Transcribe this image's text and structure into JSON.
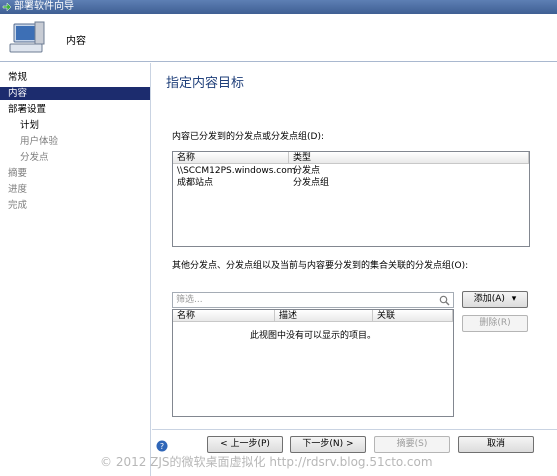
{
  "window": {
    "title": "部署软件向导"
  },
  "header": {
    "title": "内容",
    "icon": "computer-icon"
  },
  "sidebar": {
    "items": [
      {
        "label": "常规"
      },
      {
        "label": "内容"
      },
      {
        "label": "部署设置"
      },
      {
        "label": "计划"
      },
      {
        "label": "用户体验"
      },
      {
        "label": "分发点"
      },
      {
        "label": "摘要"
      },
      {
        "label": "进度"
      },
      {
        "label": "完成"
      }
    ]
  },
  "main": {
    "heading": "指定内容目标",
    "distributed_label": "内容已分发到的分发点或分发点组(D):",
    "distributed_list": {
      "columns": [
        "名称",
        "类型"
      ],
      "rows": [
        [
          "\\\\SCCM12PS.windows.com",
          "分发点"
        ],
        [
          "成都站点",
          "分发点组"
        ]
      ]
    },
    "other_label": "其他分发点、分发点组以及当前与内容要分发到的集合关联的分发点组(O):",
    "filter_placeholder": "筛选...",
    "other_list": {
      "columns": [
        "名称",
        "描述",
        "关联"
      ],
      "empty_message": "此视图中没有可以显示的项目。"
    },
    "add_button": "添加(A)",
    "remove_button": "删除(R)"
  },
  "footer": {
    "prev": "< 上一步(P)",
    "next": "下一步(N) >",
    "summary": "摘要(S)",
    "cancel": "取消"
  },
  "watermark": "© 2012 ZJS的微软桌面虚拟化 http://rdsrv.blog.51cto.com"
}
